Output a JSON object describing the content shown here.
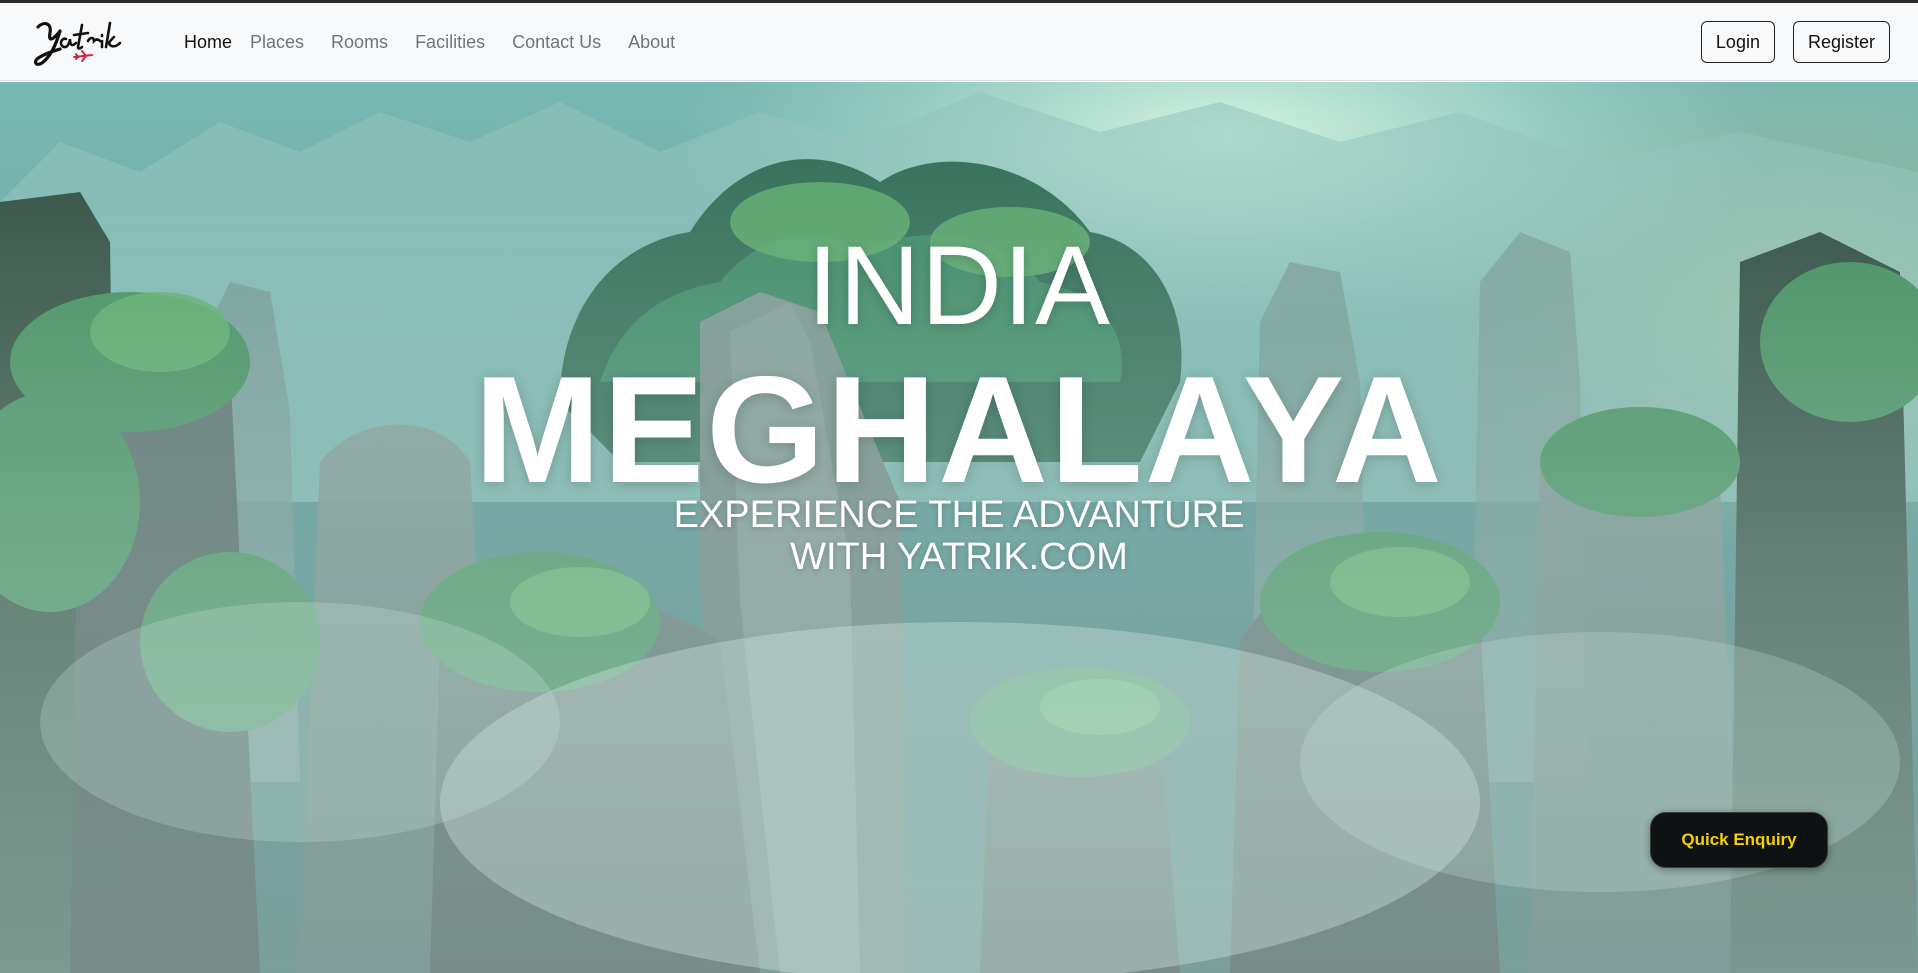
{
  "brand": {
    "logo_text": "Yatrik",
    "logo_icon": "airplane-icon"
  },
  "nav": {
    "items": [
      {
        "label": "Home",
        "active": true
      },
      {
        "label": "Places",
        "active": false
      },
      {
        "label": "Rooms",
        "active": false
      },
      {
        "label": "Facilities",
        "active": false
      },
      {
        "label": "Contact Us",
        "active": false
      },
      {
        "label": "About",
        "active": false
      }
    ]
  },
  "auth": {
    "login_label": "Login",
    "register_label": "Register"
  },
  "hero": {
    "country": "INDIA",
    "state": "MEGHALAYA",
    "tagline_line1": "EXPERIENCE THE ADVANTURE",
    "tagline_line2": "WITH YATRIK.COM",
    "background": "misty-forest-pillar-mountains"
  },
  "enquiry": {
    "label": "Quick Enquiry",
    "bg_color": "#0f1212",
    "text_color": "#f5d000"
  },
  "colors": {
    "navbar_bg": "#f8f9fa",
    "nav_text": "#6c757d",
    "nav_active": "#111111",
    "hero_text": "#ffffff"
  }
}
